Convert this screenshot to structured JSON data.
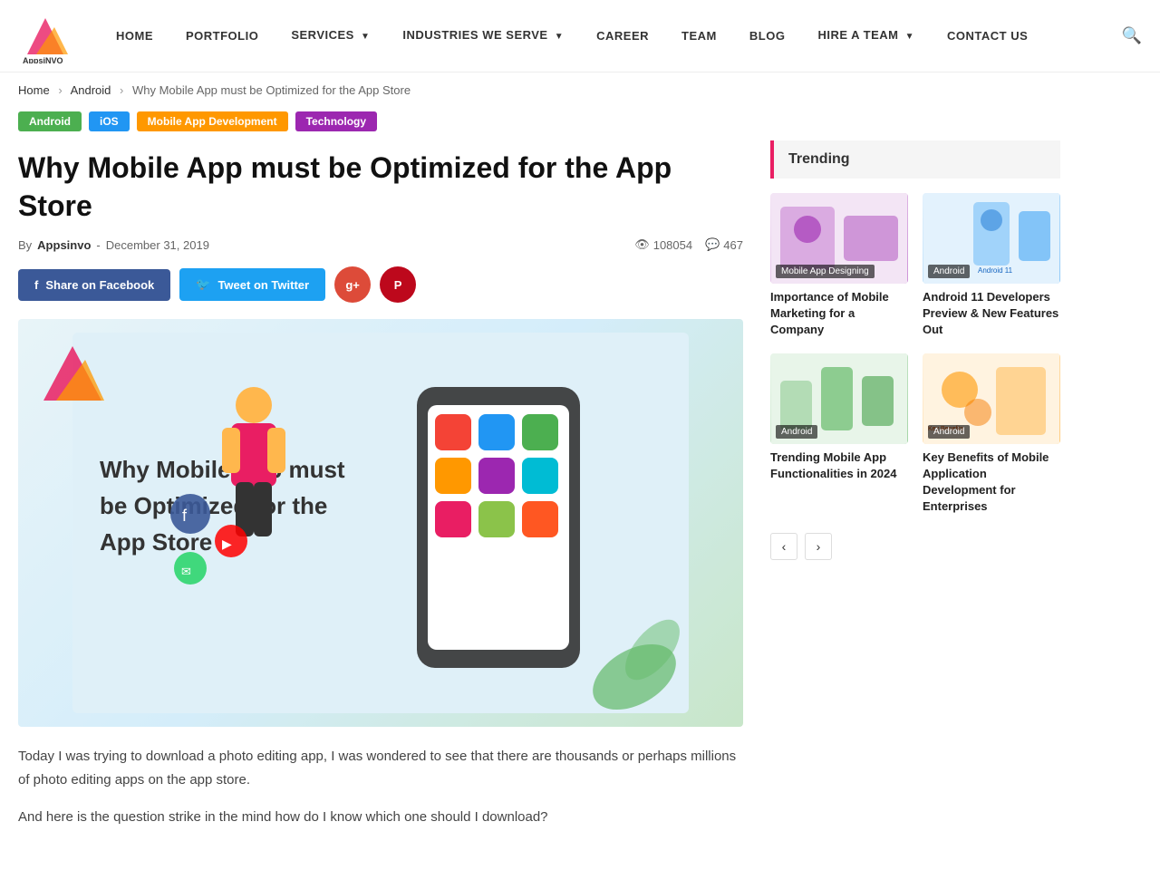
{
  "nav": {
    "logo_text": "AppsiNVO",
    "links": [
      {
        "label": "HOME",
        "has_caret": false
      },
      {
        "label": "PORTFOLIO",
        "has_caret": false
      },
      {
        "label": "SERVICES",
        "has_caret": true
      },
      {
        "label": "INDUSTRIES WE SERVE",
        "has_caret": true
      },
      {
        "label": "CAREER",
        "has_caret": false
      },
      {
        "label": "TEAM",
        "has_caret": false
      },
      {
        "label": "BLOG",
        "has_caret": false
      },
      {
        "label": "HIRE A TEAM",
        "has_caret": true
      },
      {
        "label": "CONTACT US",
        "has_caret": false
      }
    ]
  },
  "breadcrumb": {
    "items": [
      "Home",
      "Android",
      "Why Mobile App must be Optimized for the App Store"
    ]
  },
  "tags": [
    {
      "label": "Android",
      "class": "tag-android"
    },
    {
      "label": "iOS",
      "class": "tag-ios"
    },
    {
      "label": "Mobile App Development",
      "class": "tag-mobile"
    },
    {
      "label": "Technology",
      "class": "tag-tech"
    }
  ],
  "article": {
    "title": "Why Mobile App must be Optimized for the App Store",
    "by_label": "By",
    "author": "Appsinvo",
    "date": "December 31, 2019",
    "views": "108054",
    "comments": "467",
    "hero_text": "Why Mobile App must be\nOptimized for the App Store",
    "body_paragraphs": [
      "Today I was trying to download a photo editing app, I was wondered to see that there are thousands or perhaps millions of photo editing apps on the app store.",
      "And here is the question strike in the mind how do I know which one should I download?"
    ]
  },
  "share": {
    "facebook_label": "Share on Facebook",
    "twitter_label": "Tweet on Twitter"
  },
  "sidebar": {
    "trending_label": "Trending",
    "cards": [
      {
        "badge": "Mobile App Designing",
        "title": "Importance of Mobile Marketing for a Company",
        "thumb_class": "thumb-1"
      },
      {
        "badge": "Android",
        "title": "Android 11 Developers Preview & New Features Out",
        "thumb_class": "thumb-2"
      },
      {
        "badge": "Android",
        "title": "Trending Mobile App Functionalities in 2024",
        "thumb_class": "thumb-3"
      },
      {
        "badge": "Android",
        "title": "Key Benefits of Mobile Application Development for Enterprises",
        "thumb_class": "thumb-4"
      }
    ]
  },
  "pagination": {
    "prev_label": "‹",
    "next_label": "›"
  }
}
